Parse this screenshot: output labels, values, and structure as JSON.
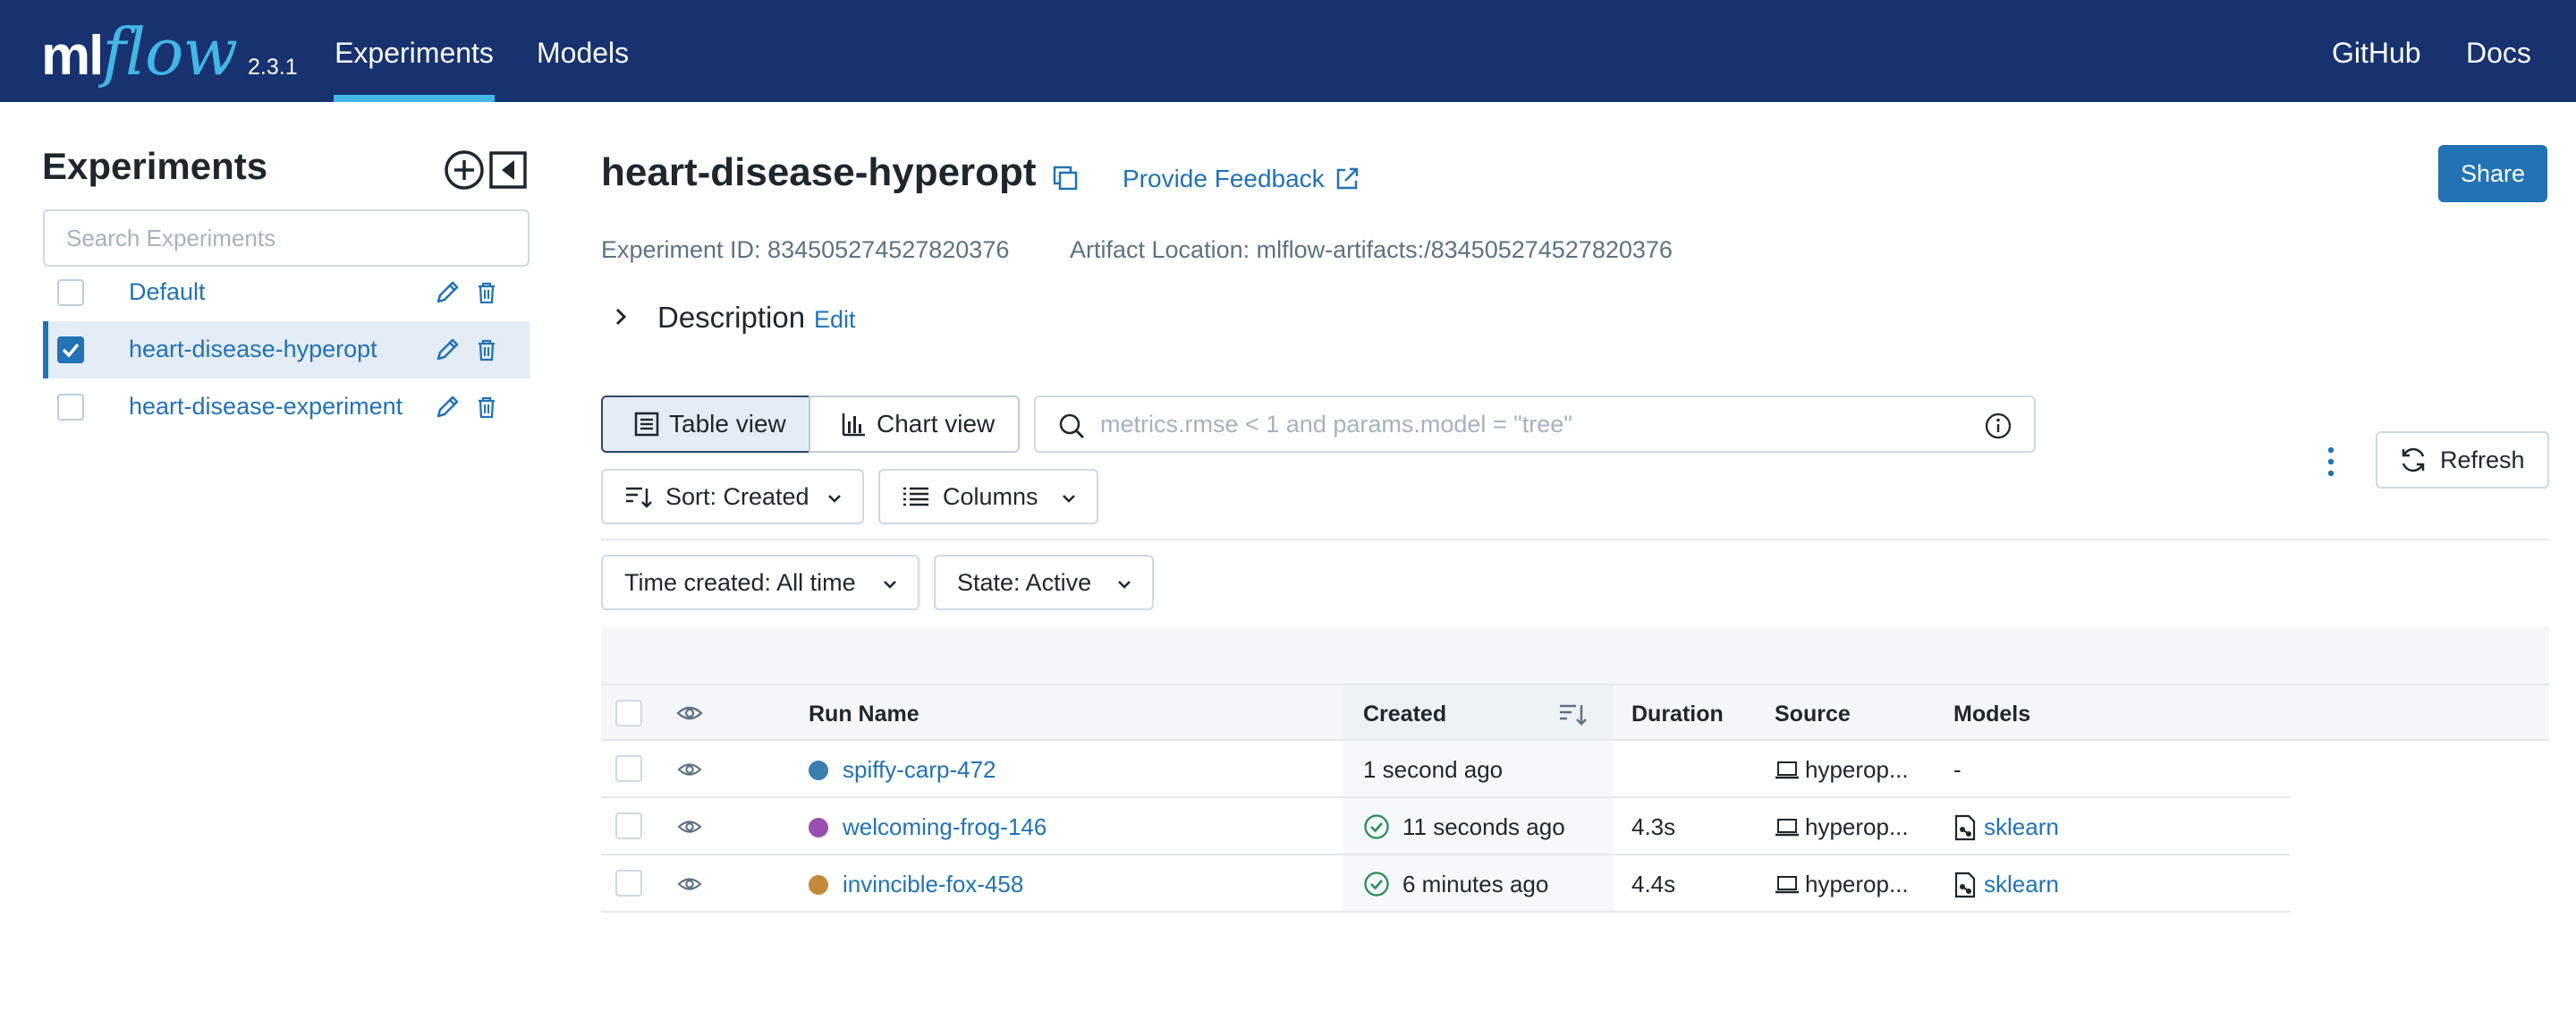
{
  "app": {
    "logo_ml": "ml",
    "logo_flow": "flow",
    "version": "2.3.1",
    "nav": {
      "experiments": "Experiments",
      "models": "Models",
      "github": "GitHub",
      "docs": "Docs"
    }
  },
  "sidebar": {
    "title": "Experiments",
    "search_placeholder": "Search Experiments",
    "experiments": [
      {
        "name": "Default",
        "checked": false
      },
      {
        "name": "heart-disease-hyperopt",
        "checked": true
      },
      {
        "name": "heart-disease-experiment",
        "checked": false
      }
    ]
  },
  "experiment": {
    "title": "heart-disease-hyperopt",
    "feedback": "Provide Feedback",
    "share": "Share",
    "id_text": "Experiment ID: 834505274527820376",
    "artifact_text": "Artifact Location: mlflow-artifacts:/834505274527820376",
    "description_label": "Description",
    "description_edit": "Edit"
  },
  "toolbar": {
    "table_view": "Table view",
    "chart_view": "Chart view",
    "filter_placeholder": "metrics.rmse < 1 and params.model = \"tree\"",
    "refresh": "Refresh",
    "sort": "Sort: Created",
    "columns": "Columns",
    "time_created": "Time created: All time",
    "state": "State: Active"
  },
  "table": {
    "headers": {
      "run_name": "Run Name",
      "created": "Created",
      "duration": "Duration",
      "source": "Source",
      "models": "Models"
    },
    "rows": [
      {
        "name": "spiffy-carp-472",
        "dot_color": "#3a7fb0",
        "created": "1 second ago",
        "finished": false,
        "duration": "",
        "source": "hyperop...",
        "model": "",
        "model_dash": "-"
      },
      {
        "name": "welcoming-frog-146",
        "dot_color": "#9a4fb0",
        "created": "11 seconds ago",
        "finished": true,
        "duration": "4.3s",
        "source": "hyperop...",
        "model": "sklearn",
        "model_dash": ""
      },
      {
        "name": "invincible-fox-458",
        "dot_color": "#c38a3a",
        "created": "6 minutes ago",
        "finished": true,
        "duration": "4.4s",
        "source": "hyperop...",
        "model": "sklearn",
        "model_dash": ""
      }
    ]
  },
  "colors": {
    "header_bg": "#17326f",
    "accent": "#43b6e8",
    "primary": "#2272b4",
    "success": "#2e8b57"
  }
}
